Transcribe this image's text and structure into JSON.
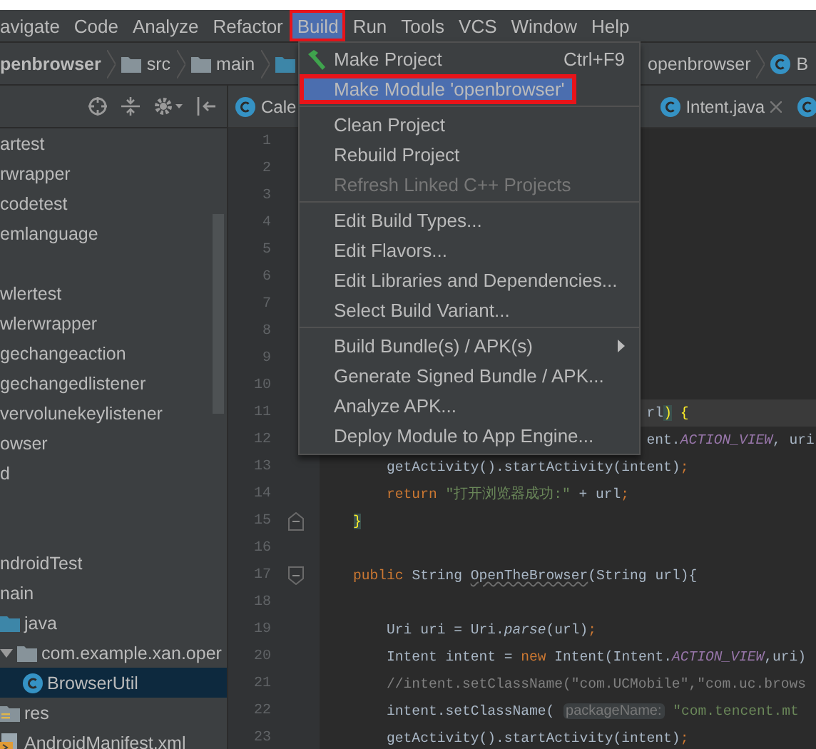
{
  "menu_bar": [
    {
      "label": "avigate",
      "selected": false
    },
    {
      "label": "Code",
      "selected": false
    },
    {
      "label": "Analyze",
      "selected": false
    },
    {
      "label": "Refactor",
      "selected": false
    },
    {
      "label": "Build",
      "selected": true,
      "outlined": true
    },
    {
      "label": "Run",
      "selected": false
    },
    {
      "label": "Tools",
      "selected": false
    },
    {
      "label": "VCS",
      "selected": false
    },
    {
      "label": "Window",
      "selected": false
    },
    {
      "label": "Help",
      "selected": false
    }
  ],
  "breadcrumb_left": [
    {
      "label": "penbrowser",
      "kind": "module"
    },
    {
      "label": "src",
      "kind": "folder"
    },
    {
      "label": "main",
      "kind": "folder"
    },
    {
      "kind": "package"
    }
  ],
  "breadcrumb_right": [
    {
      "label": "openbrowser",
      "kind": "module"
    },
    {
      "label": "B",
      "kind": "class"
    }
  ],
  "project_tree": [
    {
      "label": "artest",
      "kind": "item"
    },
    {
      "label": "rwrapper",
      "kind": "item"
    },
    {
      "label": "codetest",
      "kind": "item"
    },
    {
      "label": "emlanguage",
      "kind": "item"
    },
    {
      "kind": "offscreen"
    },
    {
      "label": "wlertest",
      "kind": "item"
    },
    {
      "label": "wlerwrapper",
      "kind": "item"
    },
    {
      "label": "gechangeaction",
      "kind": "item"
    },
    {
      "label": "gechangedlistener",
      "kind": "item"
    },
    {
      "label": "vervolunekeylistener",
      "kind": "item"
    },
    {
      "label": "owser",
      "kind": "item"
    },
    {
      "label": "d",
      "kind": "item"
    },
    {
      "kind": "offscreen"
    },
    {
      "kind": "offscreen"
    },
    {
      "label": "ndroidTest",
      "kind": "item"
    },
    {
      "label": "nain",
      "kind": "item",
      "children": [
        {
          "label": "java",
          "kind": "source-folder",
          "children": [
            {
              "label": "com.example.xan.oper",
              "kind": "package",
              "expanded": true,
              "children": [
                {
                  "label": "BrowserUtil",
                  "kind": "class",
                  "selected": true
                }
              ]
            }
          ]
        },
        {
          "label": "res",
          "kind": "resources"
        },
        {
          "label": "AndroidManifest.xml",
          "kind": "manifest"
        }
      ]
    }
  ],
  "editor_tabs": [
    {
      "label": "Cale",
      "kind": "class",
      "selected": false
    },
    {
      "label": "Intent.java",
      "kind": "class",
      "selected": false,
      "closable": true
    },
    {
      "kind": "class",
      "selected": false
    }
  ],
  "code_lines": [
    {
      "number": "1"
    },
    {
      "number": "2"
    },
    {
      "number": "3"
    },
    {
      "number": "4"
    },
    {
      "number": "5"
    },
    {
      "number": "6"
    },
    {
      "number": "7"
    },
    {
      "number": "8"
    },
    {
      "number": "9"
    },
    {
      "number": "10"
    },
    {
      "number": "11",
      "current": true,
      "tokens": [
        {
          "kind": "plain",
          "text": "                                       rl"
        },
        {
          "kind": "match",
          "text": ")"
        },
        {
          "kind": "brace",
          "text": " {"
        }
      ]
    },
    {
      "number": "12",
      "tokens": [
        {
          "kind": "plain",
          "text": "                                       ent."
        },
        {
          "kind": "constant",
          "text": "ACTION_VIEW"
        },
        {
          "kind": "plain",
          "text": ", uri"
        }
      ]
    },
    {
      "number": "13",
      "tokens": [
        {
          "kind": "plain",
          "text": "        getActivity().startActivity(intent)"
        },
        {
          "kind": "keyword",
          "text": ";"
        }
      ]
    },
    {
      "number": "14",
      "tokens": [
        {
          "kind": "keyword",
          "text": "        return "
        },
        {
          "kind": "string",
          "text": "\"打开浏览器成功:\""
        },
        {
          "kind": "plain",
          "text": " + url"
        },
        {
          "kind": "keyword",
          "text": ";"
        }
      ]
    },
    {
      "number": "15",
      "kind": "fold-end",
      "tokens": [
        {
          "kind": "match",
          "text": "    }"
        }
      ]
    },
    {
      "number": "16"
    },
    {
      "number": "17",
      "kind": "fold-start",
      "tokens": [
        {
          "kind": "keyword",
          "text": "    public "
        },
        {
          "kind": "plain",
          "text": "String "
        },
        {
          "kind": "warn",
          "text": "OpenTheBrowser"
        },
        {
          "kind": "plain",
          "text": "(String url){"
        }
      ]
    },
    {
      "number": "18"
    },
    {
      "number": "19",
      "tokens": [
        {
          "kind": "plain",
          "text": "        Uri uri = Uri."
        },
        {
          "kind": "italic",
          "text": "parse"
        },
        {
          "kind": "plain",
          "text": "(url)"
        },
        {
          "kind": "keyword",
          "text": ";"
        }
      ]
    },
    {
      "number": "20",
      "tokens": [
        {
          "kind": "plain",
          "text": "        Intent intent = "
        },
        {
          "kind": "keyword",
          "text": "new "
        },
        {
          "kind": "plain",
          "text": "Intent(Intent."
        },
        {
          "kind": "constant",
          "text": "ACTION_VIEW"
        },
        {
          "kind": "plain",
          "text": ",uri)"
        }
      ]
    },
    {
      "number": "21",
      "tokens": [
        {
          "kind": "comment",
          "text": "        //intent.setClassName(\"com.UCMobile\",\"com.uc.brows"
        }
      ]
    },
    {
      "number": "22",
      "tokens": [
        {
          "kind": "plain",
          "text": "        intent.setClassName( "
        },
        {
          "kind": "hint",
          "text": "packageName:"
        },
        {
          "kind": "string",
          "text": " \"com.tencent.mt"
        }
      ]
    },
    {
      "number": "23",
      "tokens": [
        {
          "kind": "plain",
          "text": "        getActivity().startActivity(intent)"
        },
        {
          "kind": "keyword",
          "text": ";"
        }
      ]
    }
  ],
  "build_menu": [
    {
      "kind": "tool-item",
      "label": "Make Project",
      "shortcut": "Ctrl+F9",
      "selected": false,
      "disabled": false
    },
    {
      "kind": "item",
      "label": "Make Module 'openbrowser'",
      "selected": true,
      "outlined": true,
      "disabled": false
    },
    {
      "kind": "separator"
    },
    {
      "kind": "item",
      "label": "Clean Project",
      "selected": false,
      "disabled": false
    },
    {
      "kind": "item",
      "label": "Rebuild Project",
      "selected": false,
      "disabled": false
    },
    {
      "kind": "item",
      "label": "Refresh Linked C++ Projects",
      "selected": false,
      "disabled": true
    },
    {
      "kind": "separator"
    },
    {
      "kind": "item",
      "label": "Edit Build Types...",
      "selected": false,
      "disabled": false
    },
    {
      "kind": "item",
      "label": "Edit Flavors...",
      "selected": false,
      "disabled": false
    },
    {
      "kind": "item",
      "label": "Edit Libraries and Dependencies...",
      "selected": false,
      "disabled": false
    },
    {
      "kind": "item",
      "label": "Select Build Variant...",
      "selected": false,
      "disabled": false
    },
    {
      "kind": "separator"
    },
    {
      "kind": "item",
      "label": "Build Bundle(s) / APK(s)",
      "submenu": true,
      "selected": false,
      "disabled": false
    },
    {
      "kind": "item",
      "label": "Generate Signed Bundle / APK...",
      "selected": false,
      "disabled": false
    },
    {
      "kind": "item",
      "label": "Analyze APK...",
      "selected": false,
      "disabled": false
    },
    {
      "kind": "item",
      "label": "Deploy Module to App Engine...",
      "selected": false,
      "disabled": false
    }
  ]
}
